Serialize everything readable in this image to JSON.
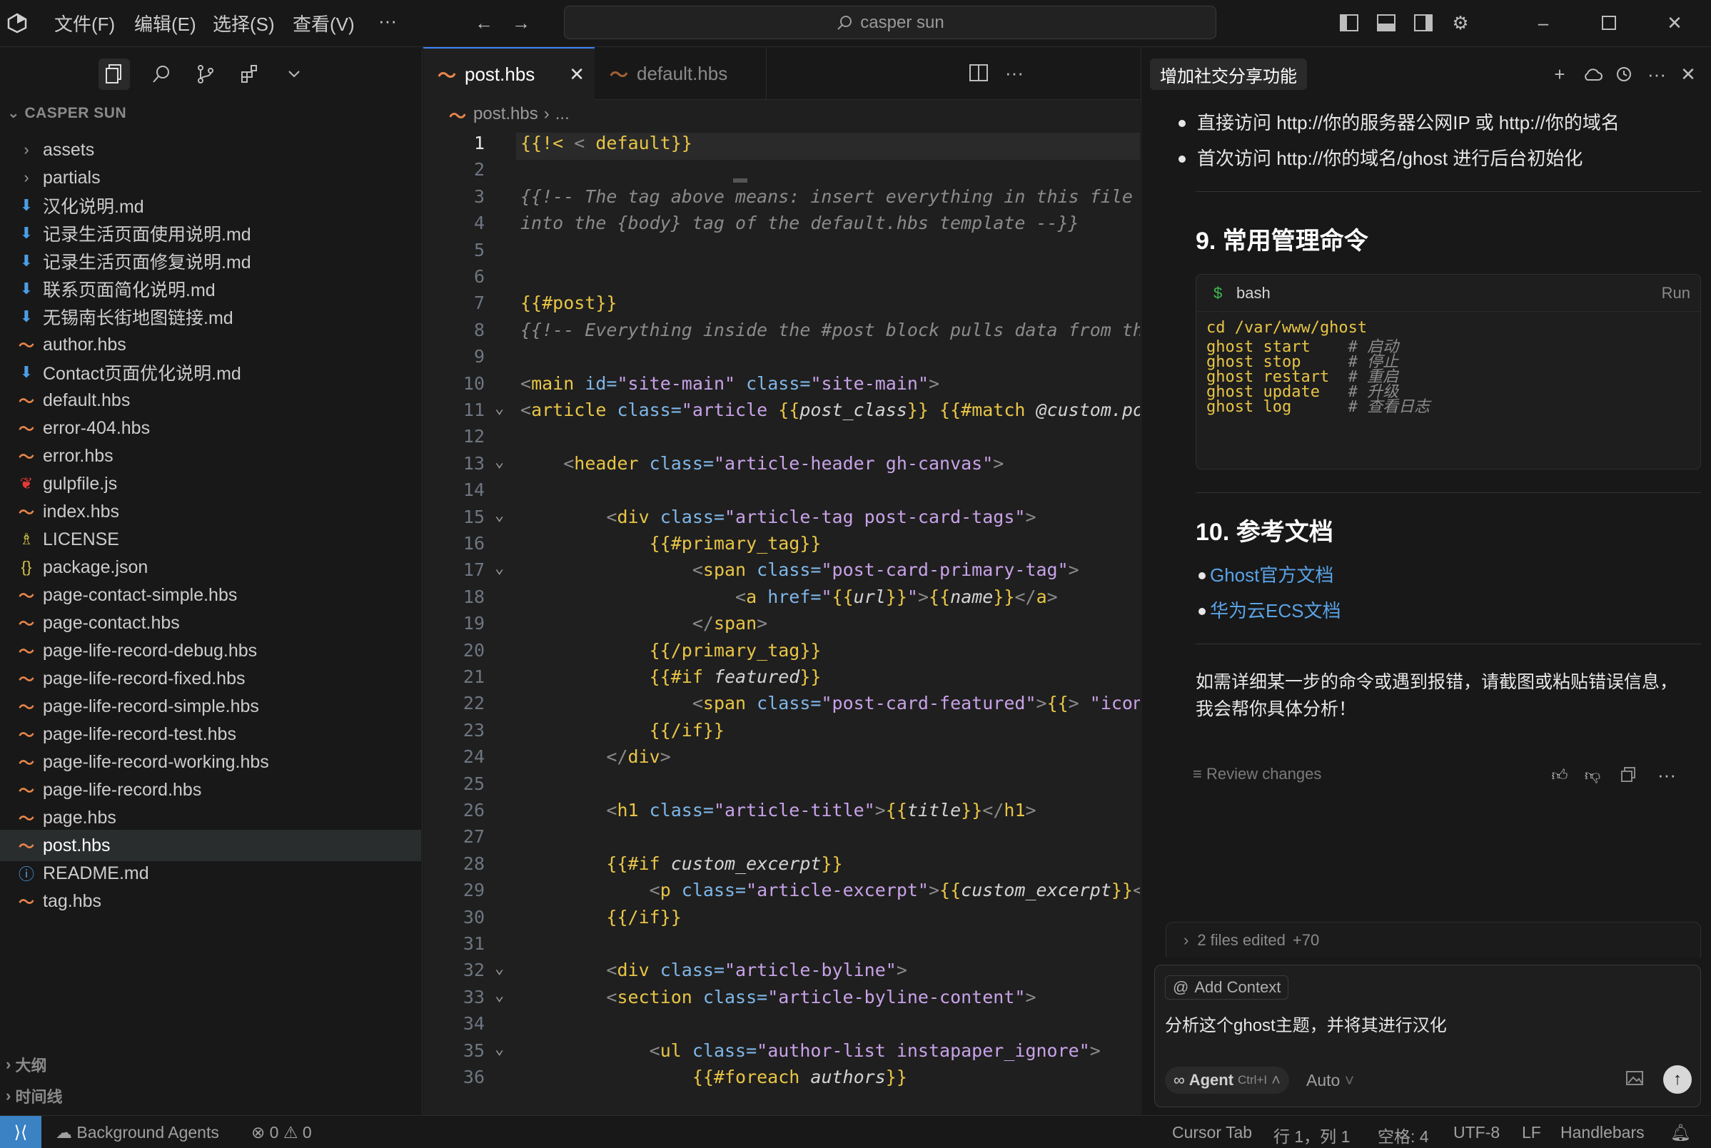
{
  "titlebar": {
    "menu": [
      "文件(F)",
      "编辑(E)",
      "选择(S)",
      "查看(V)",
      "···"
    ],
    "search": "casper sun"
  },
  "explorer": {
    "header": "CASPER SUN",
    "items": [
      {
        "label": "assets",
        "icon": "chevron-right-icon",
        "type": "folder"
      },
      {
        "label": "partials",
        "icon": "chevron-right-icon",
        "type": "folder"
      },
      {
        "label": "汉化说明.md",
        "icon": "markdown-icon",
        "type": "md"
      },
      {
        "label": "记录生活页面使用说明.md",
        "icon": "markdown-icon",
        "type": "md"
      },
      {
        "label": "记录生活页面修复说明.md",
        "icon": "markdown-icon",
        "type": "md"
      },
      {
        "label": "联系页面简化说明.md",
        "icon": "markdown-icon",
        "type": "md"
      },
      {
        "label": "无锡南长街地图链接.md",
        "icon": "markdown-icon",
        "type": "md"
      },
      {
        "label": "author.hbs",
        "icon": "handlebars-icon",
        "type": "hbs"
      },
      {
        "label": "Contact页面优化说明.md",
        "icon": "markdown-icon",
        "type": "md"
      },
      {
        "label": "default.hbs",
        "icon": "handlebars-icon",
        "type": "hbs"
      },
      {
        "label": "error-404.hbs",
        "icon": "handlebars-icon",
        "type": "hbs"
      },
      {
        "label": "error.hbs",
        "icon": "handlebars-icon",
        "type": "hbs"
      },
      {
        "label": "gulpfile.js",
        "icon": "gulp-icon",
        "type": "js"
      },
      {
        "label": "index.hbs",
        "icon": "handlebars-icon",
        "type": "hbs"
      },
      {
        "label": "LICENSE",
        "icon": "license-icon",
        "type": "lic"
      },
      {
        "label": "package.json",
        "icon": "json-icon",
        "type": "json"
      },
      {
        "label": "page-contact-simple.hbs",
        "icon": "handlebars-icon",
        "type": "hbs"
      },
      {
        "label": "page-contact.hbs",
        "icon": "handlebars-icon",
        "type": "hbs"
      },
      {
        "label": "page-life-record-debug.hbs",
        "icon": "handlebars-icon",
        "type": "hbs"
      },
      {
        "label": "page-life-record-fixed.hbs",
        "icon": "handlebars-icon",
        "type": "hbs"
      },
      {
        "label": "page-life-record-simple.hbs",
        "icon": "handlebars-icon",
        "type": "hbs"
      },
      {
        "label": "page-life-record-test.hbs",
        "icon": "handlebars-icon",
        "type": "hbs"
      },
      {
        "label": "page-life-record-working.hbs",
        "icon": "handlebars-icon",
        "type": "hbs"
      },
      {
        "label": "page-life-record.hbs",
        "icon": "handlebars-icon",
        "type": "hbs"
      },
      {
        "label": "page.hbs",
        "icon": "handlebars-icon",
        "type": "hbs"
      },
      {
        "label": "post.hbs",
        "icon": "handlebars-icon",
        "type": "hbs",
        "selected": true
      },
      {
        "label": "README.md",
        "icon": "info-icon",
        "type": "info"
      },
      {
        "label": "tag.hbs",
        "icon": "handlebars-icon",
        "type": "hbs"
      }
    ],
    "outline": "大纲",
    "timeline": "时间线"
  },
  "editor": {
    "tabs": [
      {
        "label": "post.hbs",
        "active": true
      },
      {
        "label": "default.hbs",
        "active": false
      }
    ],
    "breadcrumb": [
      "post.hbs",
      "..."
    ],
    "current_line": 1,
    "lines": [
      {
        "n": "1",
        "tokens": [
          [
            "hb",
            "{{!< "
          ],
          [
            "pun",
            "<"
          ],
          [
            "hb",
            " default}}"
          ]
        ]
      },
      {
        "n": "2",
        "tokens": []
      },
      {
        "n": "3",
        "tokens": [
          [
            "cm",
            "{{!-- The tag above means: insert everything in this file"
          ]
        ]
      },
      {
        "n": "4",
        "tokens": [
          [
            "cm",
            "into the {body} tag of the default.hbs template --}}"
          ]
        ]
      },
      {
        "n": "5",
        "tokens": []
      },
      {
        "n": "6",
        "tokens": []
      },
      {
        "n": "7",
        "tokens": [
          [
            "hb",
            "{{#post}}"
          ]
        ]
      },
      {
        "n": "8",
        "tokens": [
          [
            "cm",
            "{{!-- Everything inside the #post block pulls data from the post --}}"
          ]
        ]
      },
      {
        "n": "9",
        "tokens": []
      },
      {
        "n": "10",
        "tokens": [
          [
            "pun",
            "<"
          ],
          [
            "tag",
            "main"
          ],
          [
            "attr",
            " id="
          ],
          [
            "str",
            "\"site-main\""
          ],
          [
            "attr",
            " class="
          ],
          [
            "str",
            "\"site-main\""
          ],
          [
            "pun",
            ">"
          ]
        ]
      },
      {
        "n": "11",
        "tokens": [
          [
            "pun",
            "<"
          ],
          [
            "tag",
            "article"
          ],
          [
            "attr",
            " class="
          ],
          [
            "str",
            "\"article "
          ],
          [
            "hb",
            "{{"
          ],
          [
            "var",
            "post_class"
          ],
          [
            "hb",
            "}}"
          ],
          [
            "str",
            " "
          ],
          [
            "hb",
            "{{#match "
          ],
          [
            "var",
            "@custom.post_feed_style"
          ],
          [
            "hb",
            "}}"
          ]
        ]
      },
      {
        "n": "12",
        "tokens": []
      },
      {
        "n": "13",
        "tokens": [
          [
            "kw",
            "    "
          ],
          [
            "pun",
            "<"
          ],
          [
            "tag",
            "header"
          ],
          [
            "attr",
            " class="
          ],
          [
            "str",
            "\"article-header gh-canvas\""
          ],
          [
            "pun",
            ">"
          ]
        ]
      },
      {
        "n": "14",
        "tokens": []
      },
      {
        "n": "15",
        "tokens": [
          [
            "kw",
            "        "
          ],
          [
            "pun",
            "<"
          ],
          [
            "tag",
            "div"
          ],
          [
            "attr",
            " class="
          ],
          [
            "str",
            "\"article-tag post-card-tags\""
          ],
          [
            "pun",
            ">"
          ]
        ]
      },
      {
        "n": "16",
        "tokens": [
          [
            "kw",
            "            "
          ],
          [
            "hb",
            "{{#primary_tag}}"
          ]
        ]
      },
      {
        "n": "17",
        "tokens": [
          [
            "kw",
            "                "
          ],
          [
            "pun",
            "<"
          ],
          [
            "tag",
            "span"
          ],
          [
            "attr",
            " class="
          ],
          [
            "str",
            "\"post-card-primary-tag\""
          ],
          [
            "pun",
            ">"
          ]
        ]
      },
      {
        "n": "18",
        "tokens": [
          [
            "kw",
            "                    "
          ],
          [
            "pun",
            "<"
          ],
          [
            "tag",
            "a"
          ],
          [
            "attr",
            " href="
          ],
          [
            "str",
            "\""
          ],
          [
            "hb",
            "{{"
          ],
          [
            "var",
            "url"
          ],
          [
            "hb",
            "}}"
          ],
          [
            "str",
            "\""
          ],
          [
            "pun",
            ">"
          ],
          [
            "hb",
            "{{"
          ],
          [
            "var",
            "name"
          ],
          [
            "hb",
            "}}"
          ],
          [
            "pun",
            "</"
          ],
          [
            "tag",
            "a"
          ],
          [
            "pun",
            ">"
          ]
        ]
      },
      {
        "n": "19",
        "tokens": [
          [
            "kw",
            "                "
          ],
          [
            "pun",
            "</"
          ],
          [
            "tag",
            "span"
          ],
          [
            "pun",
            ">"
          ]
        ]
      },
      {
        "n": "20",
        "tokens": [
          [
            "kw",
            "            "
          ],
          [
            "hb",
            "{{/primary_tag}}"
          ]
        ]
      },
      {
        "n": "21",
        "tokens": [
          [
            "kw",
            "            "
          ],
          [
            "hb",
            "{{#if "
          ],
          [
            "var",
            "featured"
          ],
          [
            "hb",
            "}}"
          ]
        ]
      },
      {
        "n": "22",
        "tokens": [
          [
            "kw",
            "                "
          ],
          [
            "pun",
            "<"
          ],
          [
            "tag",
            "span"
          ],
          [
            "attr",
            " class="
          ],
          [
            "str",
            "\"post-card-featured\""
          ],
          [
            "pun",
            ">"
          ],
          [
            "hb",
            "{{"
          ],
          [
            "pun",
            "> "
          ],
          [
            "str",
            "\"icons/fire\""
          ]
        ]
      },
      {
        "n": "23",
        "tokens": [
          [
            "kw",
            "            "
          ],
          [
            "hb",
            "{{/if}}"
          ]
        ]
      },
      {
        "n": "24",
        "tokens": [
          [
            "kw",
            "        "
          ],
          [
            "pun",
            "</"
          ],
          [
            "tag",
            "div"
          ],
          [
            "pun",
            ">"
          ]
        ]
      },
      {
        "n": "25",
        "tokens": []
      },
      {
        "n": "26",
        "tokens": [
          [
            "kw",
            "        "
          ],
          [
            "pun",
            "<"
          ],
          [
            "tag",
            "h1"
          ],
          [
            "attr",
            " class="
          ],
          [
            "str",
            "\"article-title\""
          ],
          [
            "pun",
            ">"
          ],
          [
            "hb",
            "{{"
          ],
          [
            "var",
            "title"
          ],
          [
            "hb",
            "}}"
          ],
          [
            "pun",
            "</"
          ],
          [
            "tag",
            "h1"
          ],
          [
            "pun",
            ">"
          ]
        ]
      },
      {
        "n": "27",
        "tokens": []
      },
      {
        "n": "28",
        "tokens": [
          [
            "kw",
            "        "
          ],
          [
            "hb",
            "{{#if "
          ],
          [
            "var",
            "custom_excerpt"
          ],
          [
            "hb",
            "}}"
          ]
        ]
      },
      {
        "n": "29",
        "tokens": [
          [
            "kw",
            "            "
          ],
          [
            "pun",
            "<"
          ],
          [
            "tag",
            "p"
          ],
          [
            "attr",
            " class="
          ],
          [
            "str",
            "\"article-excerpt\""
          ],
          [
            "pun",
            ">"
          ],
          [
            "hb",
            "{{"
          ],
          [
            "var",
            "custom_excerpt"
          ],
          [
            "hb",
            "}}"
          ],
          [
            "pun",
            "</"
          ],
          [
            "tag",
            "p"
          ],
          [
            "pun",
            ">"
          ]
        ]
      },
      {
        "n": "30",
        "tokens": [
          [
            "kw",
            "        "
          ],
          [
            "hb",
            "{{/if}}"
          ]
        ]
      },
      {
        "n": "31",
        "tokens": []
      },
      {
        "n": "32",
        "tokens": [
          [
            "kw",
            "        "
          ],
          [
            "pun",
            "<"
          ],
          [
            "tag",
            "div"
          ],
          [
            "attr",
            " class="
          ],
          [
            "str",
            "\"article-byline\""
          ],
          [
            "pun",
            ">"
          ]
        ]
      },
      {
        "n": "33",
        "tokens": [
          [
            "kw",
            "        "
          ],
          [
            "pun",
            "<"
          ],
          [
            "tag",
            "section"
          ],
          [
            "attr",
            " class="
          ],
          [
            "str",
            "\"article-byline-content\""
          ],
          [
            "pun",
            ">"
          ]
        ]
      },
      {
        "n": "34",
        "tokens": []
      },
      {
        "n": "35",
        "tokens": [
          [
            "kw",
            "            "
          ],
          [
            "pun",
            "<"
          ],
          [
            "tag",
            "ul"
          ],
          [
            "attr",
            " class="
          ],
          [
            "str",
            "\"author-list instapaper_ignore\""
          ],
          [
            "pun",
            ">"
          ]
        ]
      },
      {
        "n": "36",
        "tokens": [
          [
            "kw",
            "                "
          ],
          [
            "hb",
            "{{#foreach "
          ],
          [
            "var",
            "authors"
          ],
          [
            "hb",
            "}}"
          ]
        ]
      }
    ],
    "folds": [
      "11",
      "13",
      "15",
      "17",
      "32",
      "33",
      "35"
    ]
  },
  "chat": {
    "title": "增加社交分享功能",
    "bullets_top": [
      "直接访问 http://你的服务器公网IP 或 http://你的域名",
      "首次访问 http://你的域名/ghost 进行后台初始化"
    ],
    "h_commands": "9. 常用管理命令",
    "code": {
      "lang": "bash",
      "run": "Run",
      "lines": [
        {
          "cmd": "cd /var/www/ghost",
          "comment": ""
        },
        {
          "cmd": "ghost start    ",
          "comment": "# 启动"
        },
        {
          "cmd": "ghost stop     ",
          "comment": "# 停止"
        },
        {
          "cmd": "ghost restart  ",
          "comment": "# 重启"
        },
        {
          "cmd": "ghost update   ",
          "comment": "# 升级"
        },
        {
          "cmd": "ghost log      ",
          "comment": "# 查看日志"
        }
      ]
    },
    "h_docs": "10. 参考文档",
    "links": [
      "Ghost官方文档",
      "华为云ECS文档"
    ],
    "closing": [
      "如需详细某一步的命令或遇到报错，请截图或粘贴错误信息，",
      "我会帮你具体分析！"
    ],
    "review": "Review changes",
    "files_edited": "2 files edited",
    "files_delta": "+70",
    "add_context": "Add Context",
    "input_value": "分析这个ghost主题，并将其进行汉化",
    "agent_label": "Agent",
    "agent_shortcut": "Ctrl+I",
    "auto_label": "Auto"
  },
  "statusbar": {
    "bg_agents": "Background Agents",
    "errors": "0",
    "warnings": "0",
    "cursor_tab": "Cursor Tab",
    "position": "行 1，列 1",
    "spaces": "空格: 4",
    "encoding": "UTF-8",
    "eol": "LF",
    "language": "Handlebars"
  },
  "colors": {
    "accent": "#3b82c4",
    "handlebars": "#e8c547",
    "string": "#c8a2e8",
    "attribute": "#7fb6e8",
    "link": "#5aa3e6"
  }
}
